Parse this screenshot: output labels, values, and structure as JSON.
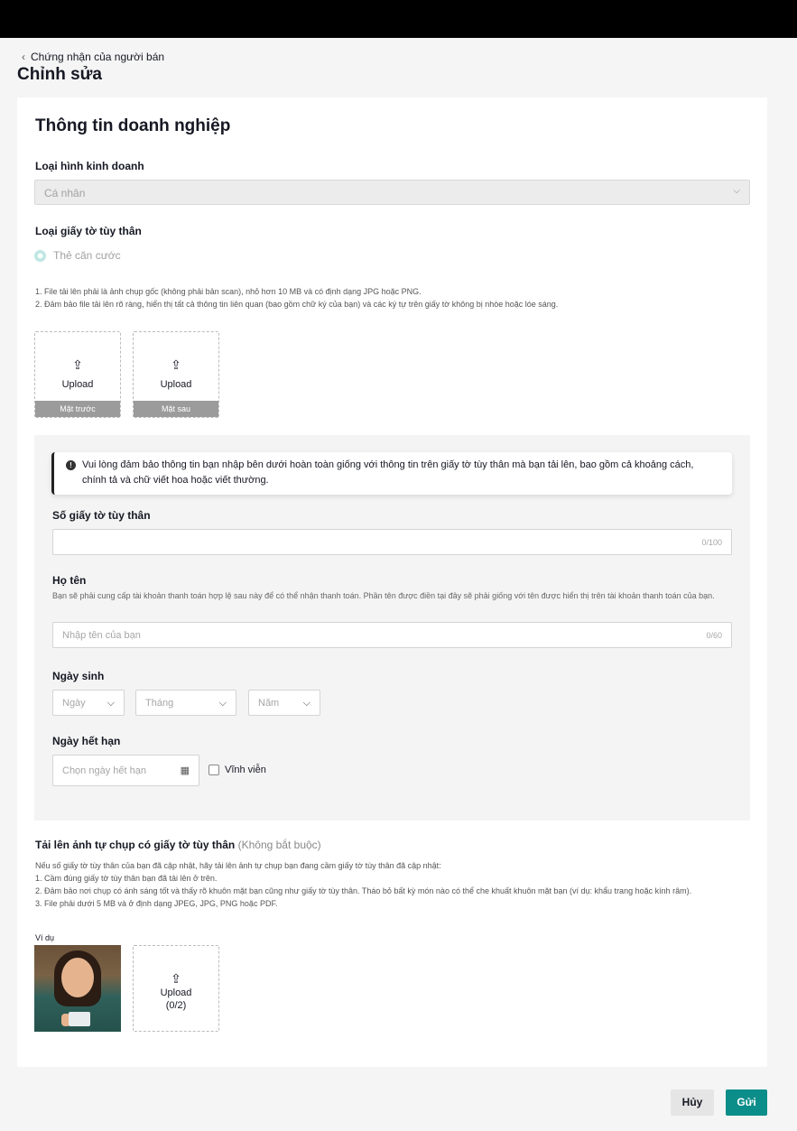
{
  "breadcrumb": {
    "label": "Chứng nhận của người bán"
  },
  "page": {
    "title": "Chỉnh sửa"
  },
  "section": {
    "title": "Thông tin doanh nghiệp"
  },
  "business_type": {
    "label": "Loại hình kinh doanh",
    "value": "Cá nhân"
  },
  "id_type": {
    "label": "Loại giấy tờ tùy thân",
    "option": "Thẻ căn cước"
  },
  "notes": {
    "line1": "1. File tải lên phải là ảnh chụp gốc (không phải bản scan), nhỏ hơn 10 MB và có định dạng JPG hoặc PNG.",
    "line2": "2. Đảm bảo file tải lên rõ ràng, hiển thị tất cả thông tin liên quan (bao gồm chữ ký của bạn) và các ký tự trên giấy tờ không bị nhòe hoặc lóe sáng."
  },
  "uploads": {
    "front": {
      "label": "Upload",
      "caption": "Mặt trước"
    },
    "back": {
      "label": "Upload",
      "caption": "Mặt sau"
    }
  },
  "alert": {
    "text": "Vui lòng đảm bảo thông tin bạn nhập bên dưới hoàn toàn giống với thông tin trên giấy tờ tùy thân mà bạn tải lên, bao gồm cả khoảng cách, chính tả và chữ viết hoa hoặc viết thường."
  },
  "id_number": {
    "label": "Số giấy tờ tùy thân",
    "counter": "0/100"
  },
  "full_name": {
    "label": "Họ tên",
    "hint": "Bạn sẽ phải cung cấp tài khoản thanh toán hợp lệ sau này để có thể nhận thanh toán. Phần tên được điền tại đây sẽ phải giống với tên được hiển thị trên tài khoản thanh toán của bạn.",
    "placeholder": "Nhập tên của bạn",
    "counter": "0/60"
  },
  "birthdate": {
    "label": "Ngày sinh",
    "day": "Ngày",
    "month": "Tháng",
    "year": "Năm"
  },
  "expiry": {
    "label": "Ngày hết hạn",
    "placeholder": "Chọn ngày hết hạn",
    "permanent": "Vĩnh viễn"
  },
  "selfie": {
    "label": "Tải lên ảnh tự chụp có giấy tờ tùy thân",
    "optional": "(Không bắt buộc)",
    "intro": "Nếu số giấy tờ tùy thân của bạn đã cập nhật, hãy tải lên ảnh tự chụp bạn đang cầm giấy tờ tùy thân đã cập nhật:",
    "rule1": "1. Cầm đúng giấy tờ tùy thân bạn đã tải lên ở trên.",
    "rule2": "2. Đảm bảo nơi chụp có ánh sáng tốt và thấy rõ khuôn mặt bạn cũng như giấy tờ tùy thân. Tháo bỏ bất kỳ món nào có thể che khuất khuôn mặt bạn (ví dụ: khẩu trang hoặc kính râm).",
    "rule3": "3. File phải dưới 5 MB và ở định dạng JPEG, JPG, PNG hoặc PDF.",
    "example_label": "Ví dụ",
    "upload_label": "Upload",
    "upload_count": "(0/2)"
  },
  "actions": {
    "cancel": "Hủy",
    "submit": "Gửi"
  },
  "colors": {
    "accent": "#0b8d8a",
    "topbar": "#000000"
  }
}
